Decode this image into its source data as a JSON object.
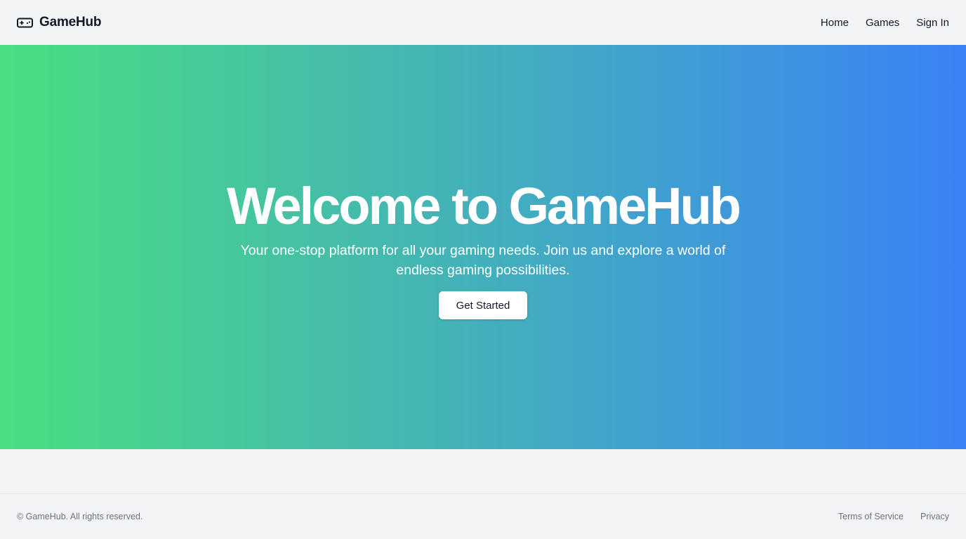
{
  "header": {
    "brand_name": "GameHub",
    "brand_icon": "gamepad-icon",
    "nav": [
      {
        "label": "Home"
      },
      {
        "label": "Games"
      },
      {
        "label": "Sign In"
      }
    ]
  },
  "hero": {
    "title": "Welcome to GameHub",
    "subtitle": "Your one-stop platform for all your gaming needs. Join us and explore a world of endless gaming possibilities.",
    "cta_label": "Get Started",
    "gradient_start": "#4ade80",
    "gradient_end": "#3b82f6"
  },
  "footer": {
    "copyright": "© GameHub. All rights reserved.",
    "links": [
      {
        "label": "Terms of Service"
      },
      {
        "label": "Privacy"
      }
    ]
  },
  "colors": {
    "background": "#f3f4f6",
    "text": "#111827",
    "muted_text": "#6b7280"
  }
}
